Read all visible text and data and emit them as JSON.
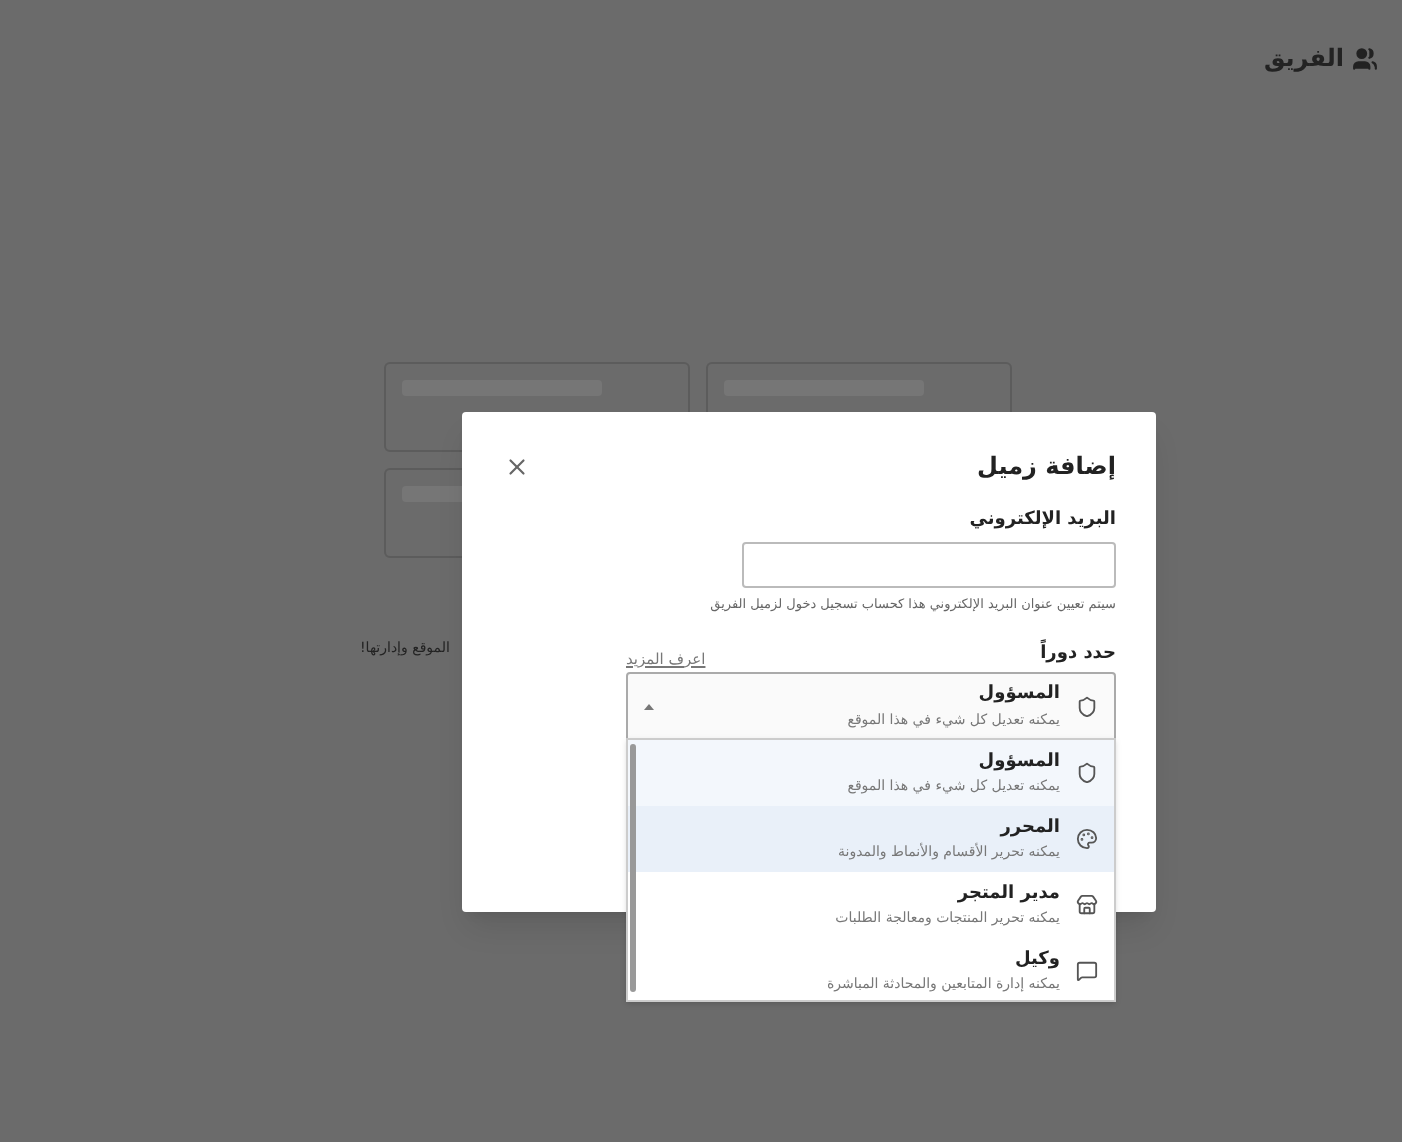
{
  "header": {
    "title": "الفريق"
  },
  "background": {
    "text": "الموقع وإدارتها!"
  },
  "dialog": {
    "title": "إضافة زميل",
    "email": {
      "label": "البريد الإلكتروني",
      "help": "سيتم تعيين عنوان البريد الإلكتروني هذا كحساب تسجيل دخول لزميل الفريق"
    },
    "role": {
      "label": "حدد دوراً",
      "learn_more": "اعرف المزيد",
      "expanded": true,
      "current": {
        "name": "المسؤول",
        "description": "يمكنه تعديل كل شيء في هذا الموقع",
        "kind": "shield"
      },
      "options": [
        {
          "name": "المسؤول",
          "description": "يمكنه تعديل كل شيء في هذا الموقع",
          "kind": "shield",
          "selected": true,
          "hovered": false
        },
        {
          "name": "المحرر",
          "description": "يمكنه تحرير الأقسام والأنماط والمدونة",
          "kind": "palette",
          "selected": false,
          "hovered": true
        },
        {
          "name": "مدير المتجر",
          "description": "يمكنه تحرير المنتجات ومعالجة الطلبات",
          "kind": "store",
          "selected": false,
          "hovered": false
        },
        {
          "name": "وكيل",
          "description": "يمكنه إدارة المتابعين والمحادثة المباشرة",
          "kind": "chat",
          "selected": false,
          "hovered": false
        }
      ]
    }
  }
}
